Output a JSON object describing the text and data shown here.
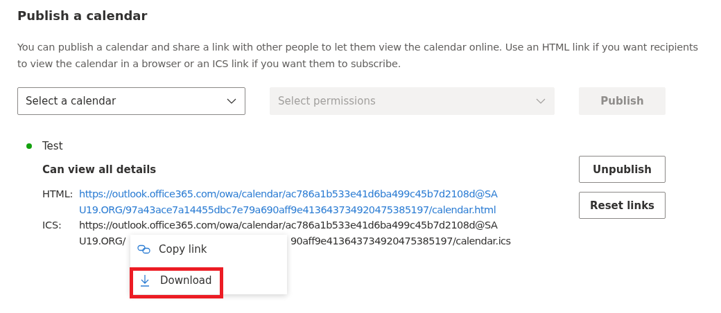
{
  "title": "Publish a calendar",
  "description": "You can publish a calendar and share a link with other people to let them view the calendar online. Use an HTML link if you want recipients to view the calendar in a browser or an ICS link if you want them to subscribe.",
  "calendar_select": {
    "placeholder": "Select a calendar",
    "disabled": false
  },
  "permissions_select": {
    "placeholder": "Select permissions",
    "disabled": true
  },
  "publish_button": {
    "label": "Publish",
    "disabled": true
  },
  "published": {
    "name": "Test",
    "color": "#13a10e",
    "permission": "Can view all details",
    "links": [
      {
        "label": "HTML:",
        "lines": [
          [
            "https://outlook.office365.com/owa/calendar/ac786a1b533e41d6ba499c45b7d2108d@SA"
          ],
          [
            "U19.ORG/97a43ace7a14455dbc7e79a690aff9e413643734920475385197/calendar.html"
          ]
        ]
      },
      {
        "label": "ICS:",
        "lines": [
          [
            "https://outlook.office365.com/owa/calendar/ac786a1b533e41d6ba499c45b7d2108d@SA"
          ],
          [
            "U19.ORG/",
            "90aff9e413643734920475385197/calendar.ics"
          ]
        ]
      }
    ],
    "buttons": [
      "Unpublish",
      "Reset links"
    ]
  },
  "context_menu": {
    "items": [
      {
        "kind": "copy",
        "label": "Copy link",
        "highlighted": false
      },
      {
        "kind": "download",
        "label": "Download",
        "highlighted": true
      }
    ]
  }
}
